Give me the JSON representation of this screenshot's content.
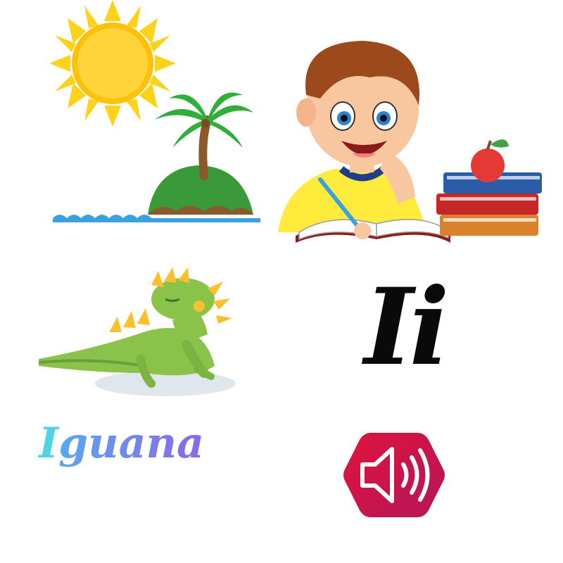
{
  "letter": {
    "upper": "I",
    "lower": "i"
  },
  "word": {
    "first_letter": "I",
    "rest": "guana"
  },
  "icons": {
    "sun": "sun-icon",
    "island": "palm-island-icon",
    "student": "student-writing-illustration",
    "books": "book-stack-icon",
    "apple": "apple-icon",
    "iguana": "iguana-icon",
    "speaker": "speaker-sound-icon"
  },
  "colors": {
    "word_first": "#4dd6e0",
    "word_rest_start": "#5aa8f0",
    "word_rest_end": "#8a67e8",
    "sound_button_start": "#c21f4e",
    "sound_button_end": "#e0133a"
  }
}
